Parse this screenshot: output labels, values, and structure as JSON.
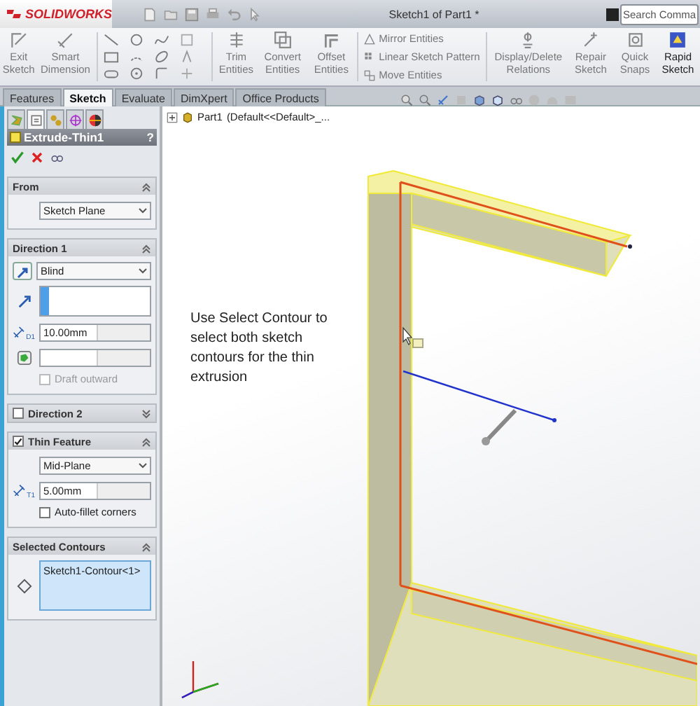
{
  "app": {
    "logo": "SOLIDWORKS",
    "title": "Sketch1 of Part1 *",
    "search": {
      "placeholder": "Search Comma"
    }
  },
  "ribbon": [
    {
      "kind": "button",
      "label": "Exit Sketch",
      "enabled": false
    },
    {
      "kind": "button",
      "label": "Smart Dimension",
      "enabled": false
    },
    {
      "kind": "tools"
    },
    {
      "kind": "button",
      "label": "Trim Entities",
      "enabled": false
    },
    {
      "kind": "button",
      "label": "Convert Entities",
      "enabled": false
    },
    {
      "kind": "button",
      "label": "Offset Entities",
      "enabled": false
    },
    {
      "kind": "list",
      "labels": [
        "Mirror Entities",
        "Linear Sketch Pattern",
        "Move Entities"
      ]
    },
    {
      "kind": "button",
      "label": "Display/Delete Relations",
      "enabled": false
    },
    {
      "kind": "button",
      "label": "Repair Sketch",
      "enabled": false
    },
    {
      "kind": "button",
      "label": "Quick Snaps",
      "enabled": false
    },
    {
      "kind": "button",
      "label": "Rapid Sketch",
      "enabled": true
    }
  ],
  "tabs": [
    {
      "label": "Features",
      "selected": false
    },
    {
      "label": "Sketch",
      "selected": true
    },
    {
      "label": "Evaluate",
      "selected": false
    },
    {
      "label": "DimXpert",
      "selected": false
    },
    {
      "label": "Office Products",
      "selected": false
    }
  ],
  "panel_tabs": [
    {
      "selected": false
    },
    {
      "selected": true
    },
    {
      "selected": false
    },
    {
      "selected": false
    },
    {
      "selected": false
    }
  ],
  "property_manager": {
    "title": "Extrude-Thin1",
    "help": "?",
    "sections": [
      {
        "title": "From",
        "expanded": true,
        "rows": [
          {
            "kind": "dropdown",
            "value": "Sketch Plane"
          }
        ]
      },
      {
        "title": "Direction 1",
        "expanded": true,
        "rows": [
          {
            "kind": "dropdown-button",
            "value": "Blind"
          },
          {
            "kind": "selection"
          },
          {
            "kind": "spin",
            "value": "10.00mm",
            "symbol": "D1"
          },
          {
            "kind": "face-spin"
          },
          {
            "kind": "checkbox",
            "label": "Draft outward",
            "checked": false,
            "disabled": true
          }
        ]
      },
      {
        "title": "Direction 2",
        "checkbox": false,
        "expanded": false
      },
      {
        "title": "Thin Feature",
        "checkbox": true,
        "expanded": true,
        "rows": [
          {
            "kind": "dropdown",
            "value": "Mid-Plane"
          },
          {
            "kind": "spin",
            "value": "5.00mm",
            "symbol": "T1"
          },
          {
            "kind": "checkbox",
            "label": "Auto-fillet corners",
            "checked": false,
            "disabled": false
          }
        ]
      },
      {
        "title": "Selected Contours",
        "expanded": true,
        "rows": [
          {
            "kind": "contours",
            "items": [
              "Sketch1-Contour<1>"
            ]
          }
        ]
      }
    ]
  },
  "tree": {
    "part": "Part1",
    "configuration": "(Default<<Default>_..."
  },
  "note": "Use Select Contour to select both sketch contours for the thin extrusion"
}
